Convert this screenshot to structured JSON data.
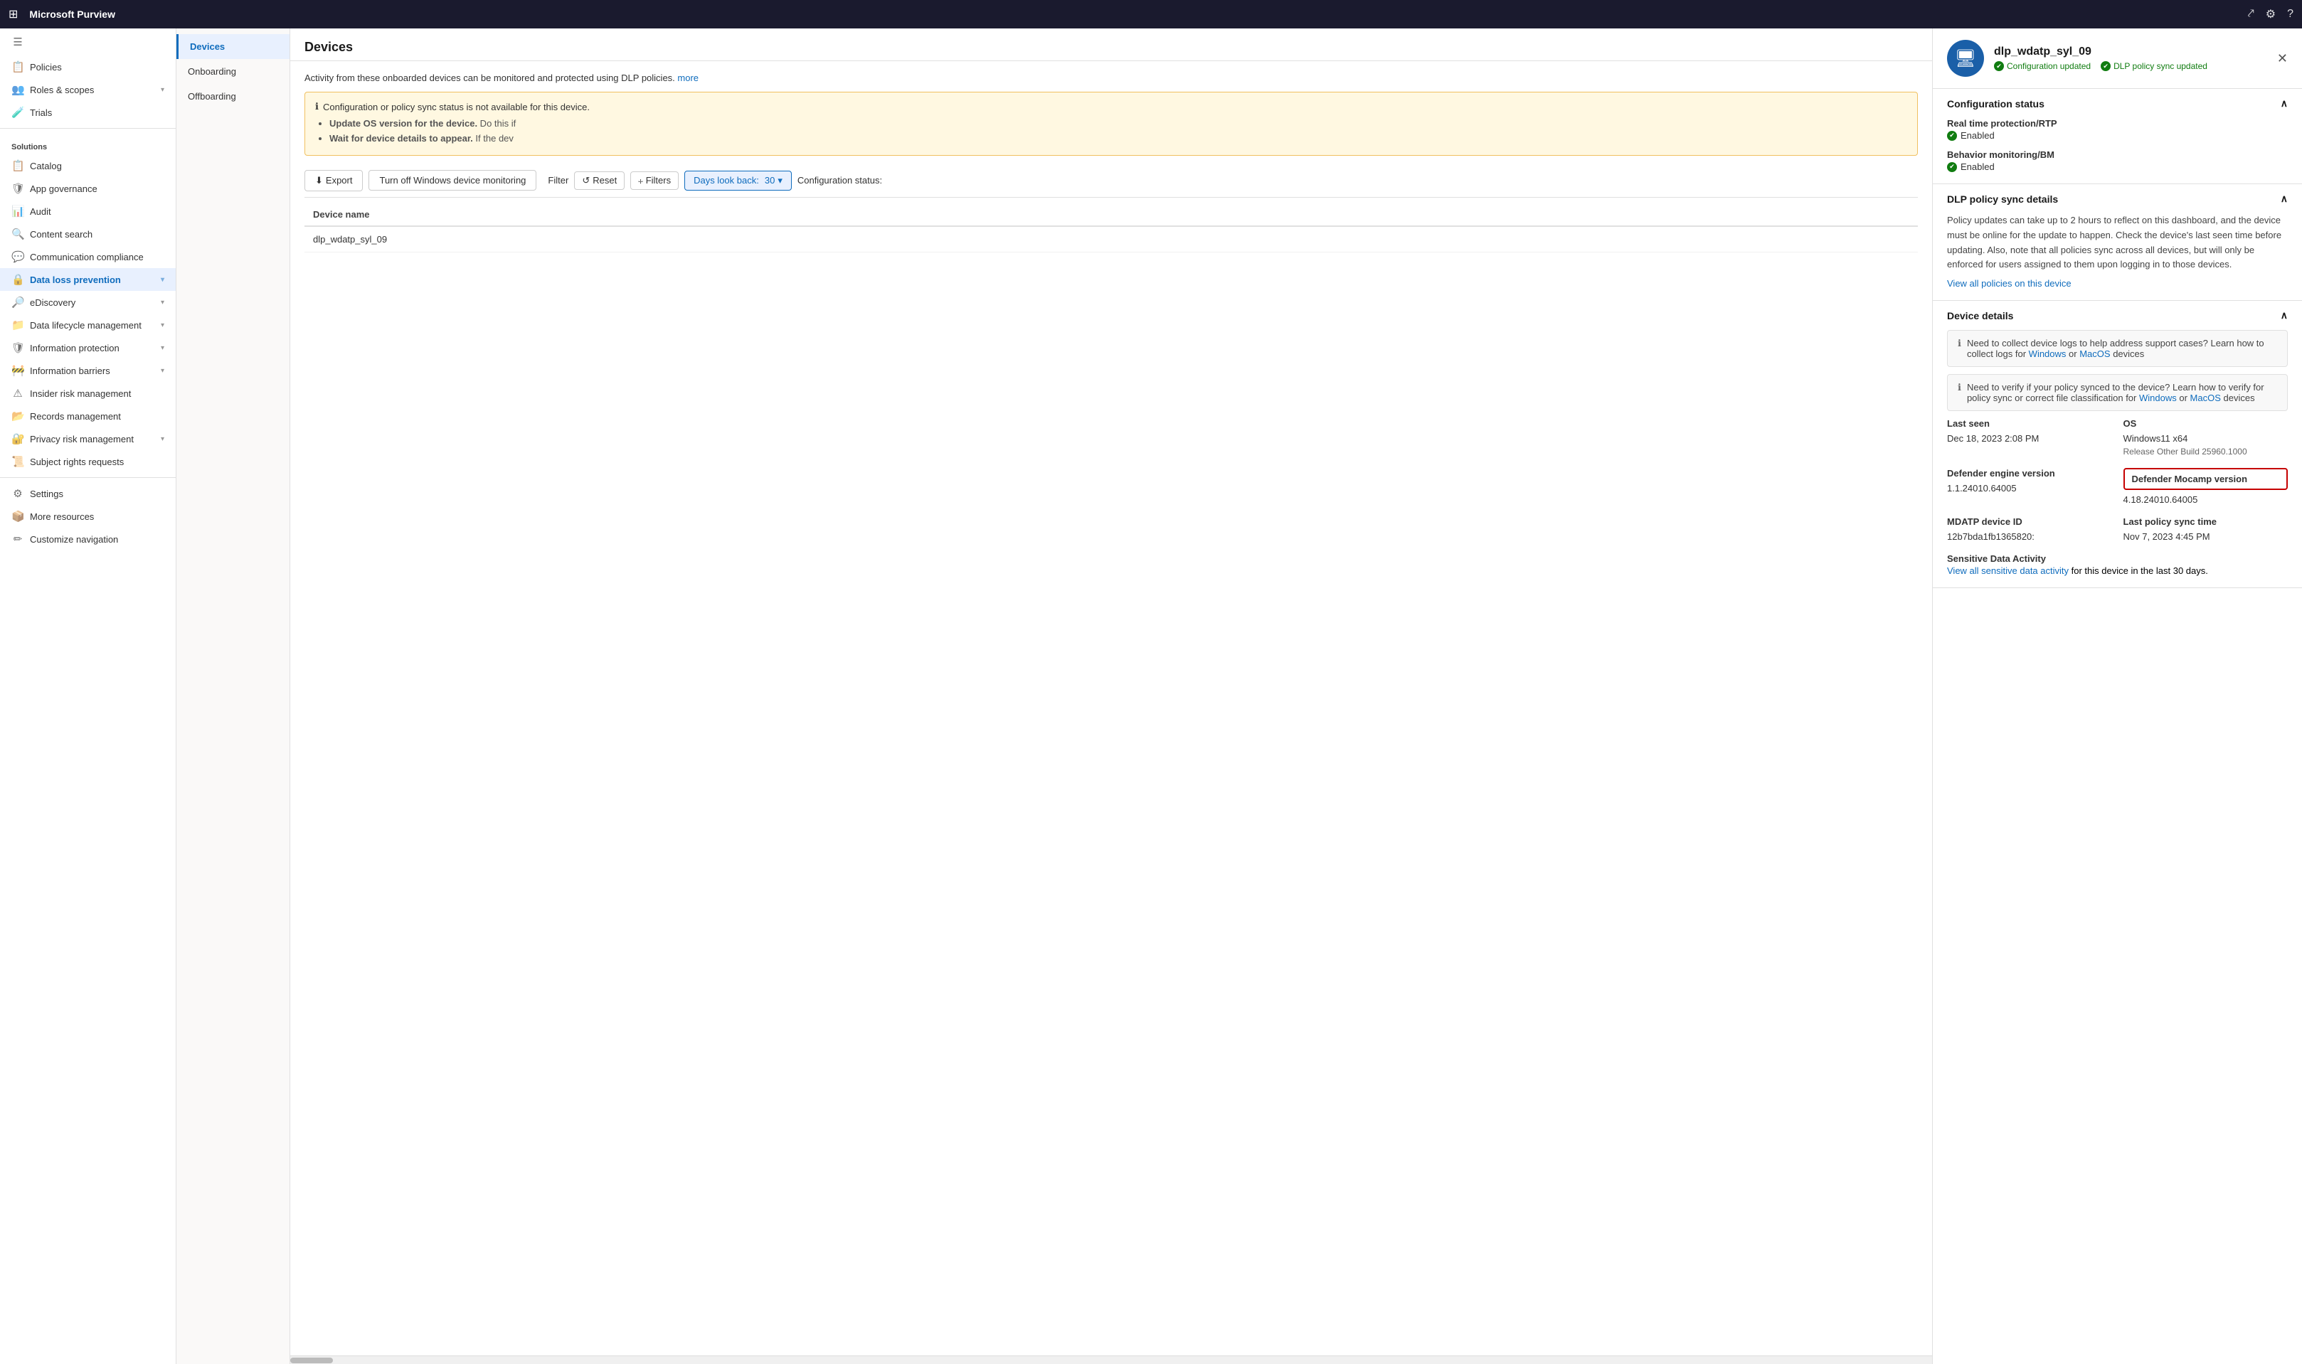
{
  "topbar": {
    "title": "Microsoft Purview",
    "grid_icon": "⊞",
    "share_icon": "⤤",
    "settings_icon": "⚙",
    "help_icon": "?"
  },
  "sidebar": {
    "sections": [
      {
        "header": "",
        "items": [
          {
            "id": "policies",
            "label": "Policies",
            "icon": "☰",
            "has_chevron": false
          },
          {
            "id": "roles-scopes",
            "label": "Roles & scopes",
            "icon": "👥",
            "has_chevron": true
          },
          {
            "id": "trials",
            "label": "Trials",
            "icon": "🧪",
            "has_chevron": false
          }
        ]
      },
      {
        "header": "Solutions",
        "items": [
          {
            "id": "catalog",
            "label": "Catalog",
            "icon": "📋",
            "has_chevron": false
          },
          {
            "id": "app-governance",
            "label": "App governance",
            "icon": "🛡",
            "has_chevron": false
          },
          {
            "id": "audit",
            "label": "Audit",
            "icon": "📊",
            "has_chevron": false
          },
          {
            "id": "content-search",
            "label": "Content search",
            "icon": "🔍",
            "has_chevron": false
          },
          {
            "id": "communication-compliance",
            "label": "Communication compliance",
            "icon": "💬",
            "has_chevron": false
          },
          {
            "id": "data-loss-prevention",
            "label": "Data loss prevention",
            "icon": "🔒",
            "has_chevron": true,
            "active": true
          },
          {
            "id": "ediscovery",
            "label": "eDiscovery",
            "icon": "🔎",
            "has_chevron": true
          },
          {
            "id": "data-lifecycle",
            "label": "Data lifecycle management",
            "icon": "📁",
            "has_chevron": true
          },
          {
            "id": "information-protection",
            "label": "Information protection",
            "icon": "🛡",
            "has_chevron": true
          },
          {
            "id": "information-barriers",
            "label": "Information barriers",
            "icon": "🚧",
            "has_chevron": true
          },
          {
            "id": "insider-risk",
            "label": "Insider risk management",
            "icon": "⚠",
            "has_chevron": false
          },
          {
            "id": "records-management",
            "label": "Records management",
            "icon": "📂",
            "has_chevron": false
          },
          {
            "id": "privacy-risk",
            "label": "Privacy risk management",
            "icon": "🔐",
            "has_chevron": true
          },
          {
            "id": "subject-rights",
            "label": "Subject rights requests",
            "icon": "📜",
            "has_chevron": false
          }
        ]
      }
    ],
    "bottom_items": [
      {
        "id": "settings",
        "label": "Settings",
        "icon": "⚙"
      },
      {
        "id": "more-resources",
        "label": "More resources",
        "icon": "📦"
      },
      {
        "id": "customize-nav",
        "label": "Customize navigation",
        "icon": "✏"
      }
    ]
  },
  "nav_panel": {
    "items": [
      {
        "id": "devices",
        "label": "Devices",
        "active": true
      },
      {
        "id": "onboarding",
        "label": "Onboarding"
      },
      {
        "id": "offboarding",
        "label": "Offboarding"
      }
    ]
  },
  "content": {
    "title": "Devices",
    "info_text": "Activity from these onboarded devices can be monitored and protected using DLP policies.",
    "info_link_text": "more",
    "warning": {
      "title": "Configuration or policy sync status is not available for this device.",
      "bullets": [
        {
          "bold": "Update OS version for the device.",
          "text": " Do this if"
        },
        {
          "bold": "Wait for device details to appear.",
          "text": " If the dev"
        }
      ]
    },
    "toolbar": {
      "export_label": "Export",
      "turn_off_label": "Turn off Windows device monitoring",
      "filter_label": "Filter",
      "reset_label": "Reset",
      "filters_label": "Filters",
      "days_label": "Days look back:",
      "days_value": "30",
      "config_status_label": "Configuration status:"
    },
    "table": {
      "columns": [
        "Device name"
      ],
      "rows": [
        {
          "device_name": "dlp_wdatp_syl_09"
        }
      ]
    }
  },
  "detail_panel": {
    "device_name": "dlp_wdatp_syl_09",
    "badge_config": "Configuration updated",
    "badge_dlp": "DLP policy sync updated",
    "close_icon": "✕",
    "sections": {
      "config_status": {
        "title": "Configuration status",
        "rtp_label": "Real time protection/RTP",
        "rtp_value": "Enabled",
        "bm_label": "Behavior monitoring/BM",
        "bm_value": "Enabled"
      },
      "dlp_policy": {
        "title": "DLP policy sync details",
        "note": "Policy updates can take up to 2 hours to reflect on this dashboard, and the device must be online for the update to happen. Check the device's last seen time before updating. Also, note that all policies sync across all devices, but will only be enforced for users assigned to them upon logging in to those devices.",
        "link_text": "View all policies on this device",
        "link_url": "#"
      },
      "device_details": {
        "title": "Device details",
        "callout1": {
          "text": "Need to collect device logs to help address support cases? Learn how to collect logs for",
          "link1_text": "Windows",
          "link2_text": "MacOS",
          "suffix": "devices"
        },
        "callout2": {
          "text": "Need to verify if your policy synced to the device? Learn how to verify for policy sync or correct file classification for",
          "link1_text": "Windows",
          "link2_text": "MacOS",
          "suffix": "devices"
        },
        "last_seen_label": "Last seen",
        "last_seen_value": "Dec 18, 2023 2:08 PM",
        "os_label": "OS",
        "os_value": "Windows11 x64",
        "os_build": "Release Other Build 25960.1000",
        "defender_engine_label": "Defender engine version",
        "defender_engine_value": "1.1.24010.64005",
        "defender_mocamp_label": "Defender Mocamp version",
        "defender_mocamp_value": "4.18.24010.64005",
        "defender_mocamp_highlighted": true,
        "mdatp_id_label": "MDATP device ID",
        "mdatp_id_value": "12b7bda1fb1365820:",
        "last_policy_sync_label": "Last policy sync time",
        "last_policy_sync_value": "Nov 7, 2023 4:45 PM",
        "sensitive_data_label": "Sensitive Data Activity",
        "sensitive_data_link": "View all sensitive data activity",
        "sensitive_data_suffix": "for this device in the last 30 days."
      }
    }
  }
}
